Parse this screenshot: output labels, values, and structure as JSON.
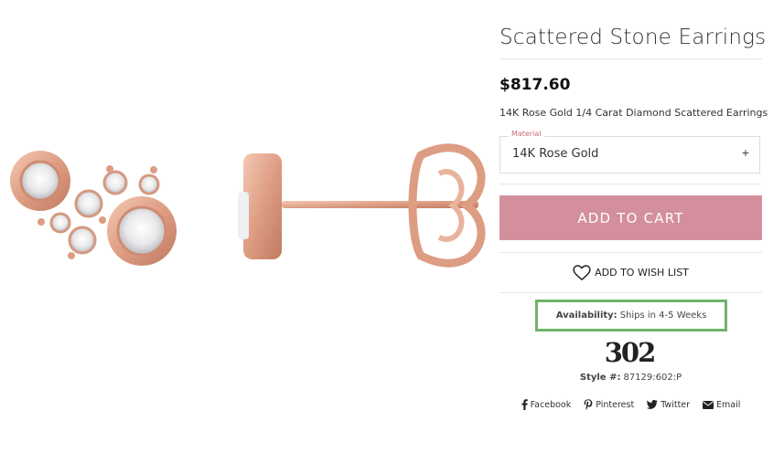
{
  "product": {
    "title": "Scattered Stone Earrings",
    "price": "$817.60",
    "description": "14K Rose Gold 1/4 Carat Diamond Scattered Earrings",
    "material_label": "Material",
    "material_value": "14K Rose Gold",
    "material_toggle": "+"
  },
  "actions": {
    "add_to_cart": "ADD TO CART",
    "wish_list": "ADD TO WISH LIST"
  },
  "availability": {
    "label": "Availability:",
    "value": "Ships in 4-5 Weeks"
  },
  "brand_logo_text": "302",
  "style": {
    "label": "Style #:",
    "value": "87129:602:P"
  },
  "social": [
    {
      "label": "Facebook",
      "icon": "facebook-icon"
    },
    {
      "label": "Pinterest",
      "icon": "pinterest-icon"
    },
    {
      "label": "Twitter",
      "icon": "twitter-icon"
    },
    {
      "label": "Email",
      "icon": "email-icon"
    }
  ],
  "colors": {
    "accent": "#d38f9c",
    "availability_border": "#6fb46a",
    "metal": "#e3a58c"
  }
}
